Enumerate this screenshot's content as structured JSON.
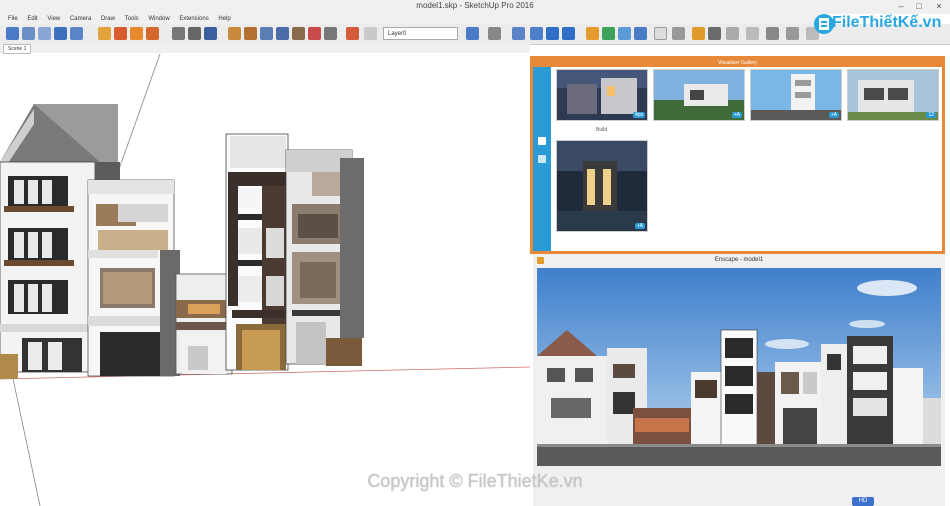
{
  "window": {
    "title": "model1.skp - SketchUp Pro 2016",
    "minimize_glyph": "–",
    "maximize_glyph": "□",
    "close_glyph": "×"
  },
  "menu": [
    "File",
    "Edit",
    "View",
    "Camera",
    "Draw",
    "Tools",
    "Window",
    "Extensions",
    "Help"
  ],
  "toolbar": {
    "layer_value": "Layer0",
    "icons": [
      "select-icon",
      "eraser-icon",
      "paint-icon",
      "line-icon",
      "rectangle-icon",
      "circle-icon",
      "arc-icon",
      "push-pull-icon",
      "move-icon",
      "rotate-icon",
      "scale-icon",
      "offset-icon",
      "tape-icon",
      "dimension-icon",
      "text-icon",
      "axes-icon",
      "orbit-icon",
      "pan-icon",
      "zoom-icon",
      "zoom-extents-icon",
      "section-icon",
      "sandbox-icon",
      "warehouse-icon",
      "render-icon"
    ]
  },
  "scenes": {
    "active": "Scene 1"
  },
  "logo": {
    "text": "FileThiếtKế.vn"
  },
  "photo_panel": {
    "title": "Visualizer Gallery",
    "tooltip": "Build",
    "thumbnails": [
      {
        "badge": "4ps"
      },
      {
        "badge": "+A"
      },
      {
        "badge": "+A"
      },
      {
        "badge": "12"
      },
      {
        "badge": "+A"
      }
    ]
  },
  "render_panel": {
    "title": "Enscape - model1"
  },
  "watermark": "Copyright © FileThietKe.vn",
  "hd_badge": "HD",
  "colors": {
    "accent_orange": "#e8893a",
    "panel_blue": "#2b9bd6",
    "logo_blue": "#2aa7e0"
  }
}
